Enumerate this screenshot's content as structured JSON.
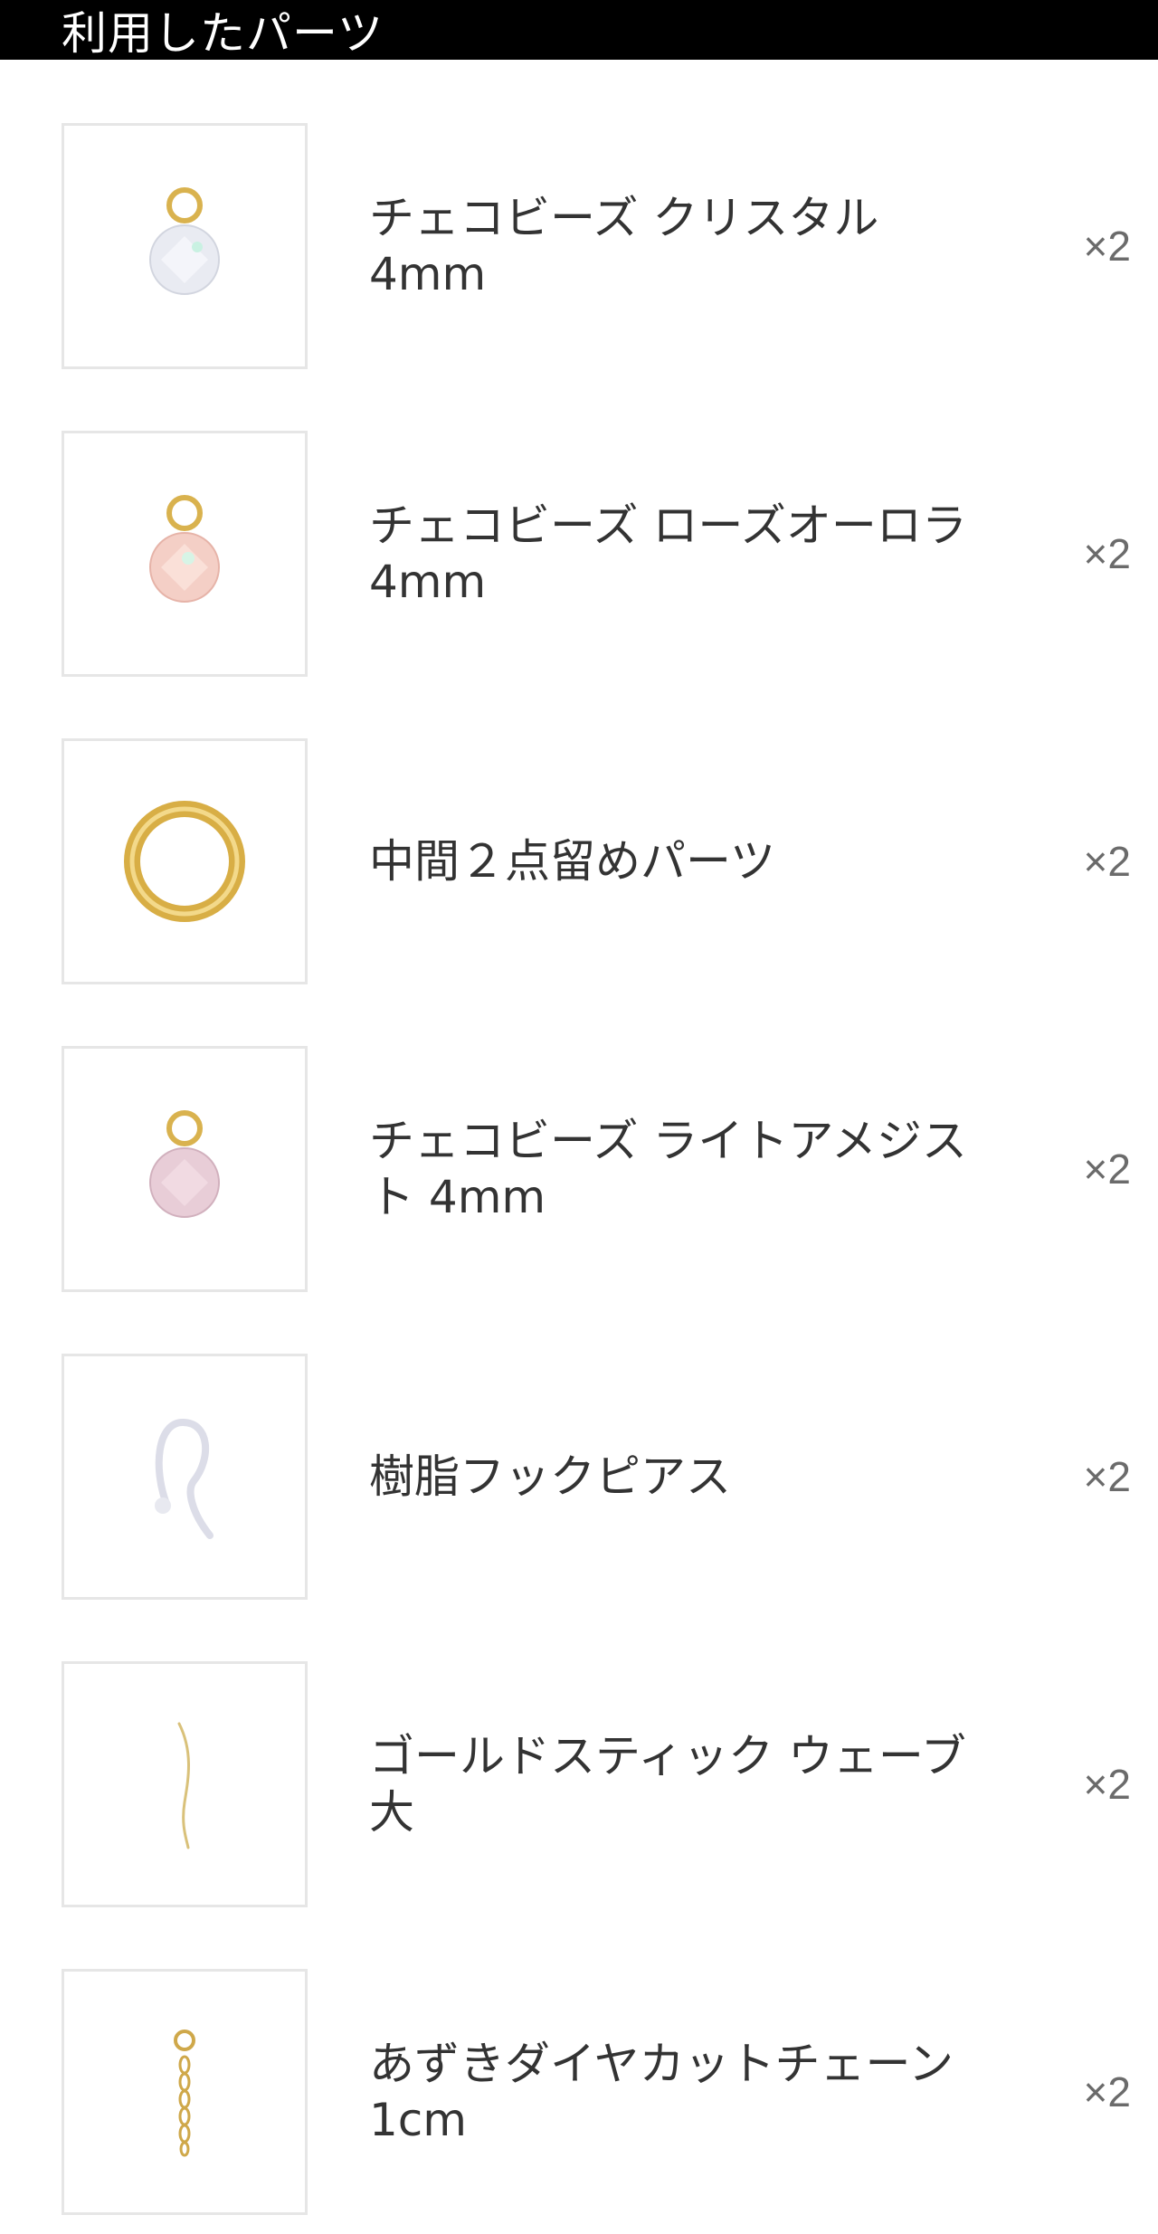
{
  "header": {
    "title": "利用したパーツ"
  },
  "parts": [
    {
      "name": "チェコビーズ クリスタル\n4mm",
      "qty": "×2",
      "icon": "crystal-bead-icon"
    },
    {
      "name": "チェコビーズ ローズオーロラ\n4mm",
      "qty": "×2",
      "icon": "rose-aurora-bead-icon"
    },
    {
      "name": "中間２点留めパーツ",
      "qty": "×2",
      "icon": "gold-ring-icon"
    },
    {
      "name": "チェコビーズ ライトアメジス\nト 4mm",
      "qty": "×2",
      "icon": "amethyst-bead-icon"
    },
    {
      "name": "樹脂フックピアス",
      "qty": "×2",
      "icon": "resin-hook-earring-icon"
    },
    {
      "name": "ゴールドスティック ウェーブ\n大",
      "qty": "×2",
      "icon": "gold-wave-stick-icon"
    },
    {
      "name": "あずきダイヤカットチェーン\n1cm",
      "qty": "×2",
      "icon": "azuki-chain-icon"
    }
  ]
}
